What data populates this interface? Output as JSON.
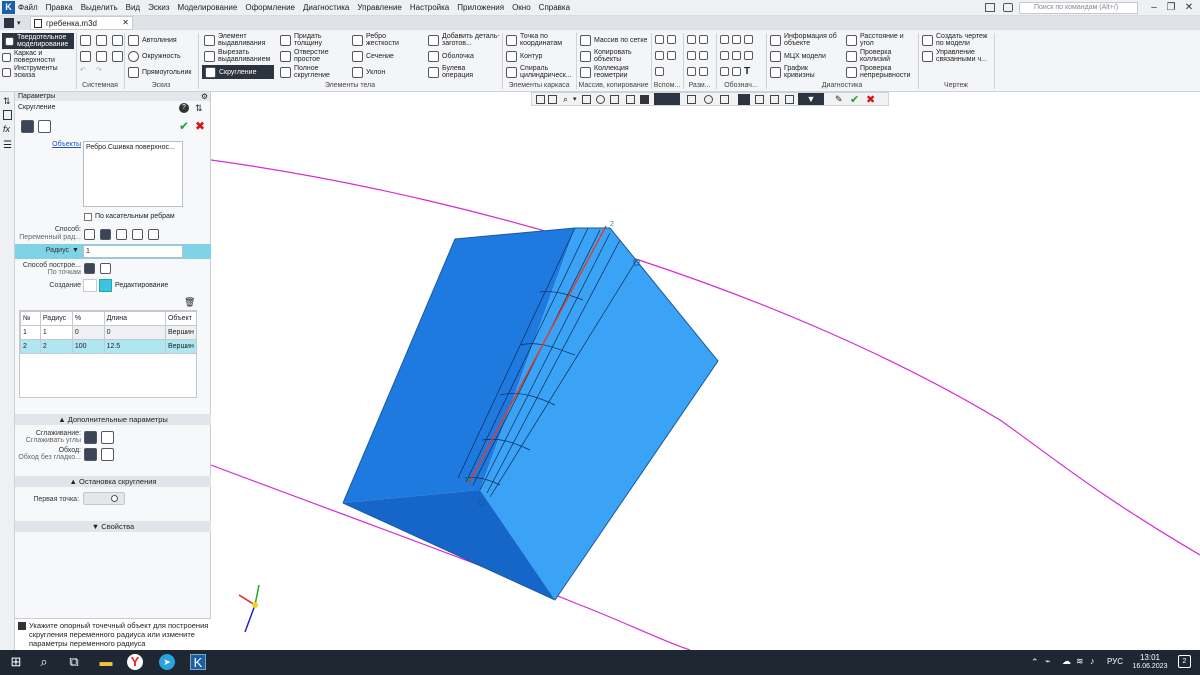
{
  "app": {
    "window_title_tab": "гребенка.m3d",
    "search_placeholder": "Поиск по командам (Alt+/)"
  },
  "menu": [
    "Файл",
    "Правка",
    "Выделить",
    "Вид",
    "Эскиз",
    "Моделирование",
    "Оформление",
    "Диагностика",
    "Управление",
    "Настройка",
    "Приложения",
    "Окно",
    "Справка"
  ],
  "ribbon": {
    "modes": [
      "Твердотельное моделирование",
      "Каркас и поверхности",
      "Инструменты эскиза"
    ],
    "sketch": [
      "Автолиния",
      "Окружность",
      "Прямоугольник"
    ],
    "body": [
      "Элемент выдавливания",
      "Вырезать выдавливанием",
      "Скругление",
      "Придать толщину",
      "Отверстие простое",
      "Полное скругление",
      "Ребро жесткости",
      "Сечение",
      "Уклон",
      "Добавить деталь-заготов...",
      "Оболочка",
      "Булева операция"
    ],
    "frame": [
      "Точка по координатам",
      "Контур",
      "Спираль цилиндрическ..."
    ],
    "array": [
      "Массив по сетке",
      "Копировать объекты",
      "Коллекция геометрии"
    ],
    "diag": [
      "Информация об объекте",
      "МЦХ модели",
      "График кривизны",
      "Расстояние и угол",
      "Проверка коллизий",
      "Проверка непрерывности"
    ],
    "drawing": [
      "Создать чертеж по модели",
      "Управление связанными ч..."
    ],
    "groups": [
      "Системная",
      "Эскиз",
      "Элементы тела",
      "Элементы каркаса",
      "Массив, копирование",
      "Вспом...",
      "Разм...",
      "Обознач...",
      "Диагностика",
      "Чертеж"
    ]
  },
  "panel": {
    "header": "Параметры",
    "title": "Скругление",
    "objects_link": "Объекты",
    "objects_value": "Ребро.Сшивка поверхнос...",
    "tangent_checkbox": "По касательным ребрам",
    "method_label": "Способ:",
    "method_value": "Переменный рад...",
    "radius_label": "Радиус",
    "radius_value": "1",
    "build_label": "Способ построе...",
    "build_value": "По точкам",
    "create_label": "Создание",
    "create_value": "Редактирование",
    "table": {
      "headers": [
        "№",
        "Радиус",
        "%",
        "Длина",
        "Объект"
      ],
      "rows": [
        [
          "1",
          "1",
          "0",
          "0",
          "Вершин"
        ],
        [
          "2",
          "2",
          "100",
          "12.5",
          "Вершин"
        ]
      ]
    },
    "extra_section": "Дополнительные параметры",
    "smoothing_label": "Сглаживание:",
    "smoothing_value": "Сглаживать углы",
    "bypass_label": "Обход:",
    "bypass_value": "Обход без гладко...",
    "stop_section": "Остановка скругления",
    "first_point_label": "Первая точка:",
    "properties_section": "Свойства",
    "hint": "Укажите опорный точечный объект для построения скругления переменного радиуса или измените параметры переменного радиуса"
  },
  "taskbar": {
    "lang": "РУС",
    "time": "13:01",
    "date": "16.06.2023",
    "notif": "2"
  },
  "colors": {
    "model_dark": "#1f7ae0",
    "model_light": "#3aa3f5",
    "curve": "#d62ad6"
  }
}
